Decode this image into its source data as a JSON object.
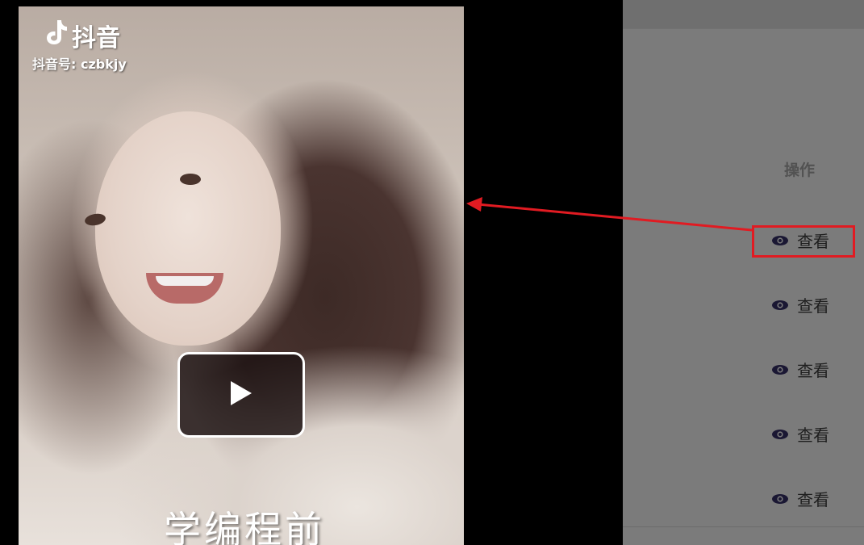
{
  "video": {
    "logo_icon": "tiktok-note-icon",
    "logo_text": "抖音",
    "account_id": "抖音号: czbkjy",
    "caption": "学编程前",
    "play_icon": "play-icon"
  },
  "table": {
    "column_header": "操作",
    "rows": [
      {
        "icon": "eye-icon",
        "label": "查看"
      },
      {
        "icon": "eye-icon",
        "label": "查看"
      },
      {
        "icon": "eye-icon",
        "label": "查看"
      },
      {
        "icon": "eye-icon",
        "label": "查看"
      },
      {
        "icon": "eye-icon",
        "label": "查看"
      }
    ]
  },
  "annotation": {
    "highlight_color": "#e11b22",
    "arrow_color": "#e11b22"
  }
}
